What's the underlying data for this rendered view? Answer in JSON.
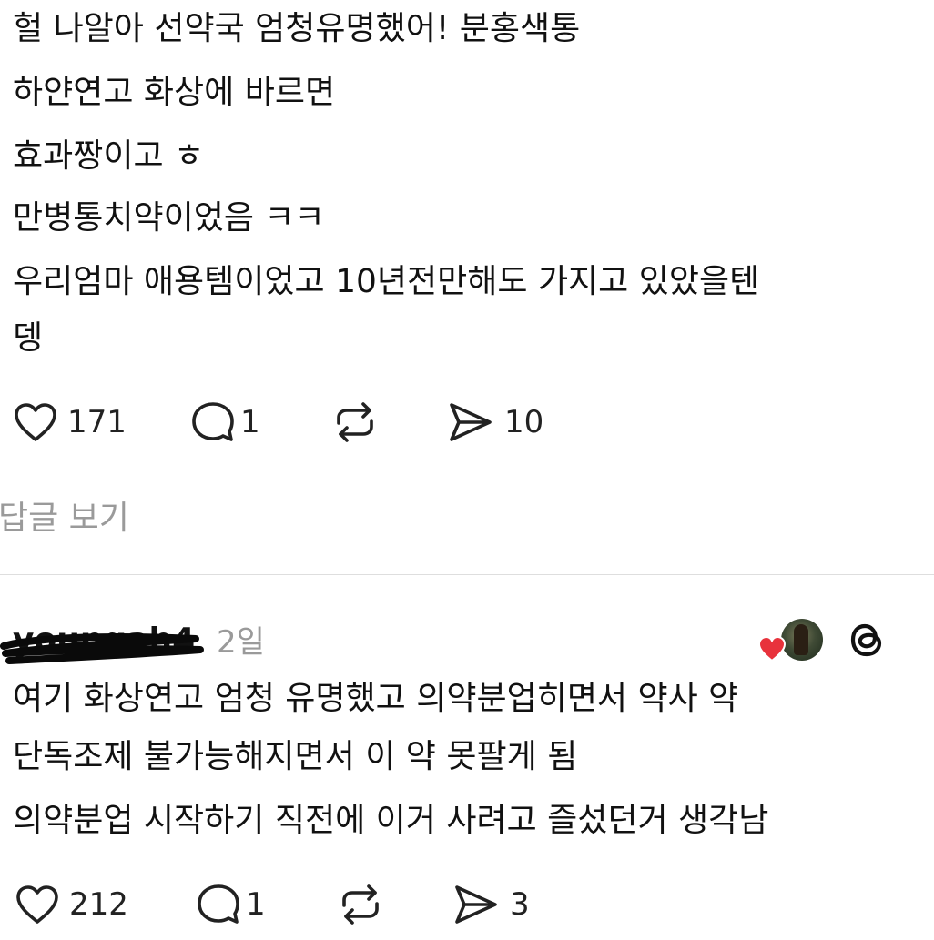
{
  "post1": {
    "lines": [
      "헐 나알아 선약국 엄청유명했어! 분홍색통",
      "하얀연고 화상에 바르면",
      "효과짱이고 ㅎ",
      "만병통치약이었음 ㅋㅋ",
      "우리엄마 애용템이었고 10년전만해도 가지고 있았을텐",
      "뎅"
    ],
    "actions": {
      "like_count": "171",
      "reply_count": "1",
      "repost_count": "",
      "share_count": "10"
    },
    "view_replies_label": "답글 보기"
  },
  "post2": {
    "username": "youngah4",
    "timestamp": "2일",
    "lines": [
      "여기 화상연고 엄청 유명했고 의약분업히면서 약사 약",
      "단독조제 불가능해지면서 이 약 못팔게 됨",
      "의약분업 시작하기 직전에 이거 사려고 즐섰던거 생각남"
    ],
    "actions": {
      "like_count": "212",
      "reply_count": "1",
      "repost_count": "",
      "share_count": "3"
    }
  },
  "colors": {
    "text": "#111111",
    "muted": "#9a9a9a",
    "heart_badge": "#e8323c",
    "divider": "#dedede"
  },
  "icons": [
    "heart-icon",
    "reply-icon",
    "repost-icon",
    "share-icon",
    "threads-icon",
    "avatar"
  ]
}
